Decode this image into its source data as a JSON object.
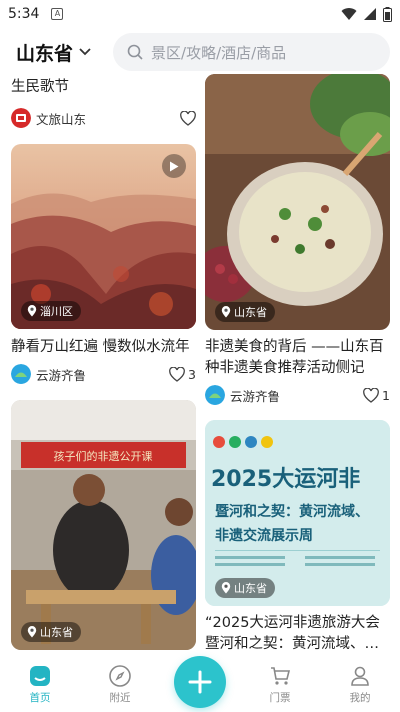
{
  "status": {
    "time": "5:34",
    "notice": "A"
  },
  "header": {
    "province": "山东省",
    "search_placeholder": "景区/攻略/酒店/商品"
  },
  "feed": {
    "cards": [
      {
        "title": "生民歌节",
        "author": "文旅山东",
        "likes": ""
      },
      {
        "title": "静看万山红遍 慢数似水流年",
        "author": "云游齐鲁",
        "likes": "3",
        "location": "淄川区"
      },
      {
        "title": "“2025大运河非遗旅游大会 暨河和之契：黄河流域、…",
        "author": "",
        "likes": "",
        "location": "山东省",
        "poster_title": "2025大运河非",
        "poster_sub1": "暨河和之契：黄河流域、",
        "poster_sub2": "非遗交流展示周"
      },
      {
        "title": "非遗美食的背后 ——山东百种非遗美食推荐活动侧记",
        "author": "云游齐鲁",
        "likes": "1",
        "location": "山东省"
      },
      {
        "title": "",
        "author": "",
        "likes": "",
        "location": "山东省",
        "banner": "孩子们的非遗公开课"
      }
    ]
  },
  "nav": {
    "items": [
      {
        "label": "首页"
      },
      {
        "label": "附近"
      },
      {
        "label": "门票"
      },
      {
        "label": "我的"
      }
    ]
  },
  "colors": {
    "accent": "#2cc3cc",
    "nav_active": "#23b4c3"
  }
}
